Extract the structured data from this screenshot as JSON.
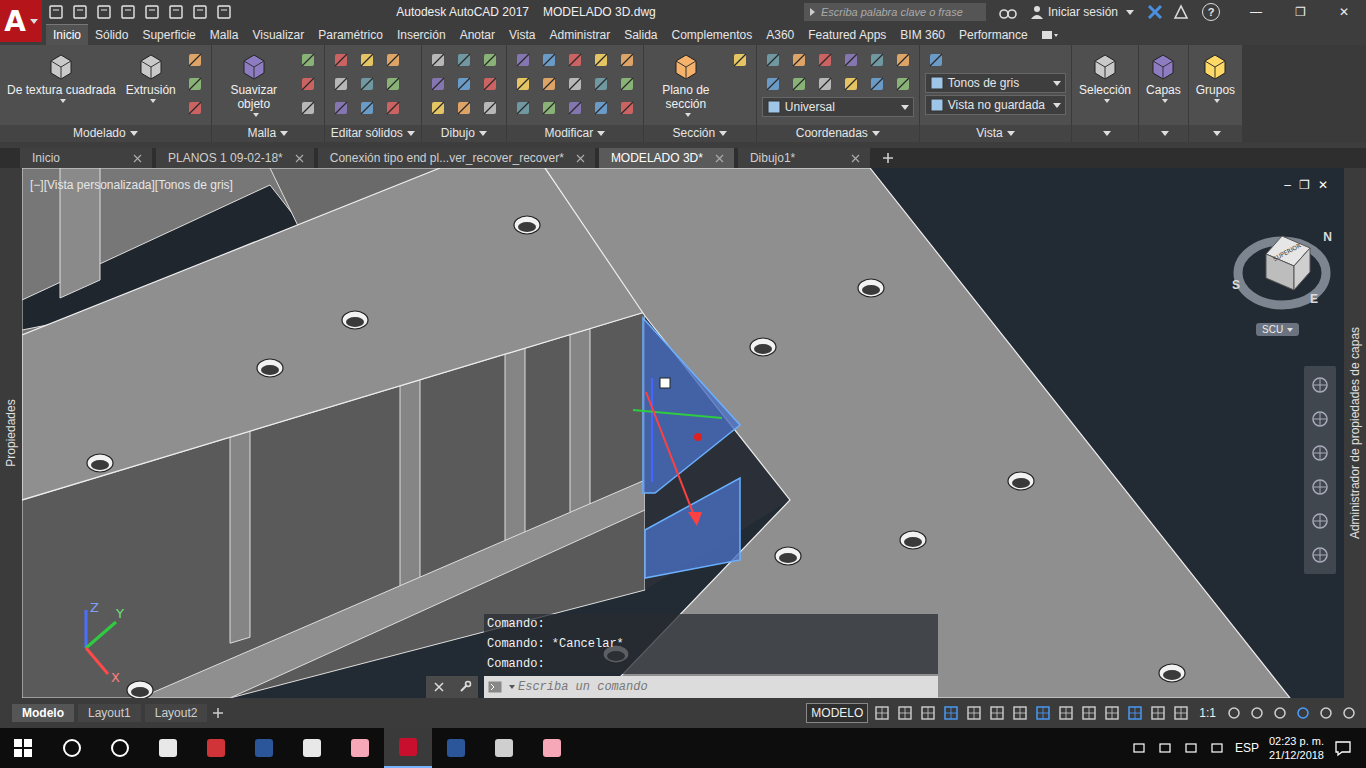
{
  "title_bar": {
    "logo": "A",
    "app": "Autodesk AutoCAD 2017",
    "file": "MODELADO 3D.dwg",
    "search_placeholder": "Escriba palabra clave o frase",
    "sign_in": "Iniciar sesión",
    "help": "?",
    "window_controls": [
      "—",
      "❐",
      "✕"
    ]
  },
  "ribbon_tabs": [
    {
      "label": "Inicio",
      "selected": true
    },
    {
      "label": "Sólido",
      "selected": false
    },
    {
      "label": "Superficie",
      "selected": false
    },
    {
      "label": "Malla",
      "selected": false
    },
    {
      "label": "Visualizar",
      "selected": false
    },
    {
      "label": "Paramétrico",
      "selected": false
    },
    {
      "label": "Inserción",
      "selected": false
    },
    {
      "label": "Anotar",
      "selected": false
    },
    {
      "label": "Vista",
      "selected": false
    },
    {
      "label": "Administrar",
      "selected": false
    },
    {
      "label": "Salida",
      "selected": false
    },
    {
      "label": "Complementos",
      "selected": false
    },
    {
      "label": "A360",
      "selected": false
    },
    {
      "label": "Featured Apps",
      "selected": false
    },
    {
      "label": "BIM 360",
      "selected": false
    },
    {
      "label": "Performance",
      "selected": false
    }
  ],
  "panels": [
    {
      "title": "Modelado",
      "buttons": [
        "De textura cuadrada",
        "Extrusión"
      ],
      "dropdowns": []
    },
    {
      "title": "Malla",
      "buttons": [
        "Suavizar objeto"
      ],
      "dropdowns": []
    },
    {
      "title": "Editar sólidos",
      "buttons": [],
      "dropdowns": []
    },
    {
      "title": "Dibujo",
      "buttons": [],
      "dropdowns": []
    },
    {
      "title": "Modificar",
      "buttons": [],
      "dropdowns": []
    },
    {
      "title": "Sección",
      "buttons": [
        "Plano de sección"
      ],
      "dropdowns": []
    },
    {
      "title": "Coordenadas",
      "buttons": [],
      "dropdowns": [
        "Universal"
      ]
    },
    {
      "title": "Vista",
      "buttons": [],
      "dropdowns": [
        "Tonos de gris",
        "Vista no guardada"
      ]
    },
    {
      "title": "",
      "buttons": [
        "Selección"
      ],
      "dropdowns": []
    },
    {
      "title": "",
      "buttons": [
        "Capas"
      ],
      "dropdowns": []
    },
    {
      "title": "",
      "buttons": [
        "Grupos"
      ],
      "dropdowns": []
    }
  ],
  "doc_tabs": [
    {
      "label": "Inicio",
      "selected": false
    },
    {
      "label": "PLANOS 1 09-02-18*",
      "selected": false
    },
    {
      "label": "Conexión tipo end pl...ver_recover_recover*",
      "selected": false
    },
    {
      "label": "MODELADO 3D*",
      "selected": true
    },
    {
      "label": "Dibujo1*",
      "selected": false
    }
  ],
  "side_panels": {
    "left": "Propiedades",
    "right": "Administrador de propiedades de capas"
  },
  "viewport": {
    "label": "[−][Vista personalizada][Tonos de gris]",
    "controls": [
      "–",
      "❐",
      "✕"
    ],
    "viewcube_face": "SUPERIOR",
    "compass": [
      {
        "letter": "N",
        "pos": "ne"
      },
      {
        "letter": "S",
        "pos": "sw"
      },
      {
        "letter": "E",
        "pos": "se"
      }
    ],
    "ucs_menu": "SCU",
    "ucs_axes": {
      "x": "X",
      "y": "Y",
      "z": "Z"
    }
  },
  "command": {
    "history": [
      "Comando:",
      "Comando: *Cancelar*",
      "Comando:"
    ],
    "placeholder": "Escriba un comando"
  },
  "layout_tabs": [
    {
      "label": "Modelo",
      "selected": true
    },
    {
      "label": "Layout1",
      "selected": false
    },
    {
      "label": "Layout2",
      "selected": false
    }
  ],
  "status_bar": {
    "mode": "MODELO",
    "scale": "1:1"
  },
  "taskbar": {
    "apps": [
      {
        "active": false
      },
      {
        "active": false
      },
      {
        "active": false
      },
      {
        "active": false
      },
      {
        "active": false
      },
      {
        "active": false
      },
      {
        "active": false
      },
      {
        "active": true
      },
      {
        "active": false
      },
      {
        "active": false
      },
      {
        "active": false
      }
    ],
    "language": "ESP",
    "time": "02:23 p. m.",
    "date": "21/12/2018"
  }
}
